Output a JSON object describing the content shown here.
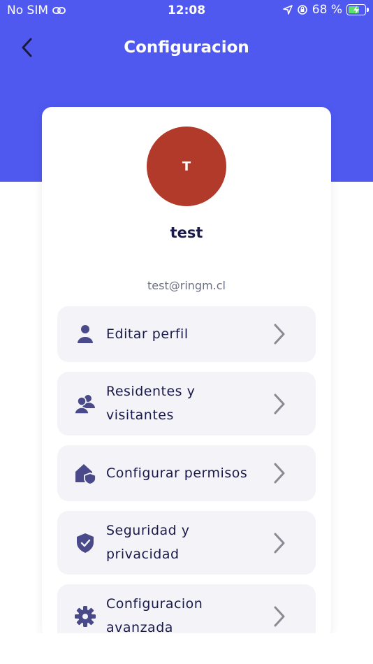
{
  "status_bar": {
    "carrier": "No SIM",
    "time": "12:08",
    "battery_percent": "68 %"
  },
  "header": {
    "title": "Configuracion"
  },
  "profile": {
    "initial": "T",
    "name": "test",
    "email": "test@ringm.cl",
    "avatar_color": "#b23a2b"
  },
  "menu": [
    {
      "label": "Editar perfil",
      "icon": "user-icon"
    },
    {
      "label": "Residentes y visitantes",
      "icon": "users-icon"
    },
    {
      "label": "Configurar permisos",
      "icon": "house-shield-icon"
    },
    {
      "label": "Seguridad y privacidad",
      "icon": "shield-check-icon"
    },
    {
      "label": "Configuracion avanzada",
      "icon": "gear-icon"
    }
  ],
  "colors": {
    "header": "#4f59f0",
    "icon": "#4a4a8a",
    "chevron": "#8a8a94",
    "text": "#1a1a4a"
  }
}
